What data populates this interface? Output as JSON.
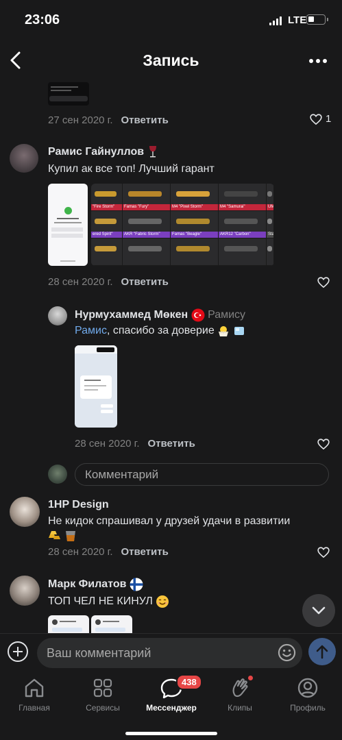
{
  "status_bar": {
    "time": "23:06",
    "network": "LTE",
    "battery_percent": 25
  },
  "header": {
    "title": "Запись"
  },
  "comments": [
    {
      "date": "27 сен 2020 г.",
      "reply_label": "Ответить",
      "likes": "1"
    },
    {
      "author": "Рамис Гайнуллов",
      "author_emoji": "wine-glass-icon",
      "text": "Купил  ак все топ! Лучший гарант",
      "date": "28 сен 2020 г.",
      "reply_label": "Ответить",
      "skins": [
        "\"Fire Storm\"",
        "Famas \"Fury\"",
        "M4 \"Pixel Storm\"",
        "M4 \"Samurai\"",
        "UMP",
        "ered Spirit\"",
        "AKR \"Fabric Storm\"",
        "Famas \"Beagle\"",
        "AKR12 \"Carbon\"",
        "StatTrack"
      ]
    },
    {
      "author": "Нурмухаммед Мөкен",
      "author_emoji": "turkey-flag-icon",
      "reply_to": "Рамису",
      "mention": "Рамис",
      "text": ", спасибо за доверие",
      "date": "28 сен 2020 г.",
      "reply_label": "Ответить"
    },
    {
      "author": "1HP Design",
      "text": "Не кидок спрашивал у друзей удачи в развитии",
      "date": "28 сен 2020 г.",
      "reply_label": "Ответить"
    },
    {
      "author": "Марк Филатов",
      "author_emoji": "finland-flag-icon",
      "text": "ТОП ЧЕЛ НЕ КИНУЛ"
    }
  ],
  "reply_input": {
    "placeholder": "Комментарий"
  },
  "composer": {
    "placeholder": "Ваш комментарий"
  },
  "tabs": [
    {
      "label": "Главная"
    },
    {
      "label": "Сервисы"
    },
    {
      "label": "Мессенджер",
      "badge": "438"
    },
    {
      "label": "Клипы"
    },
    {
      "label": "Профиль"
    }
  ],
  "colors": {
    "background": "#19191a",
    "accent": "#71aaeb",
    "badge": "#e64646"
  }
}
